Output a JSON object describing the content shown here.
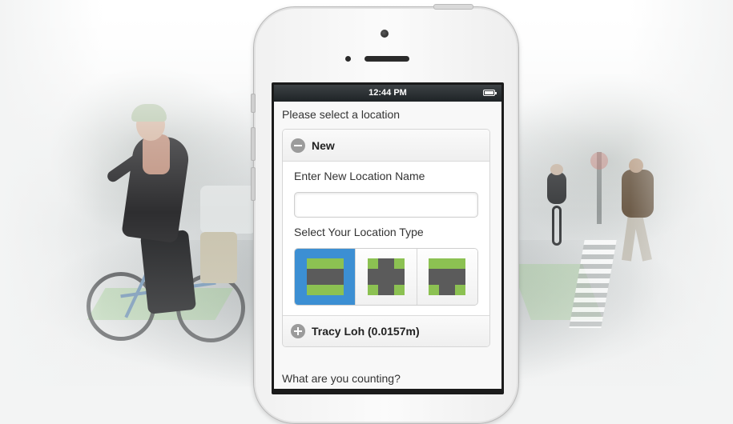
{
  "status_bar": {
    "time": "12:44 PM"
  },
  "form": {
    "prompt": "Please select a location",
    "new_section": {
      "title": "New",
      "name_label": "Enter New Location Name",
      "name_value": "",
      "type_label": "Select Your Location Type",
      "location_types": [
        {
          "icon": "road-segment-icon",
          "selected": true
        },
        {
          "icon": "intersection-icon",
          "selected": false
        },
        {
          "icon": "t-intersection-icon",
          "selected": false
        }
      ]
    },
    "existing_location": {
      "title": "Tracy Loh (0.0157m)"
    },
    "next_prompt": "What are you counting?"
  },
  "colors": {
    "selected": "#3c8fd3",
    "grass": "#8cc152",
    "road": "#5b5b5b"
  }
}
